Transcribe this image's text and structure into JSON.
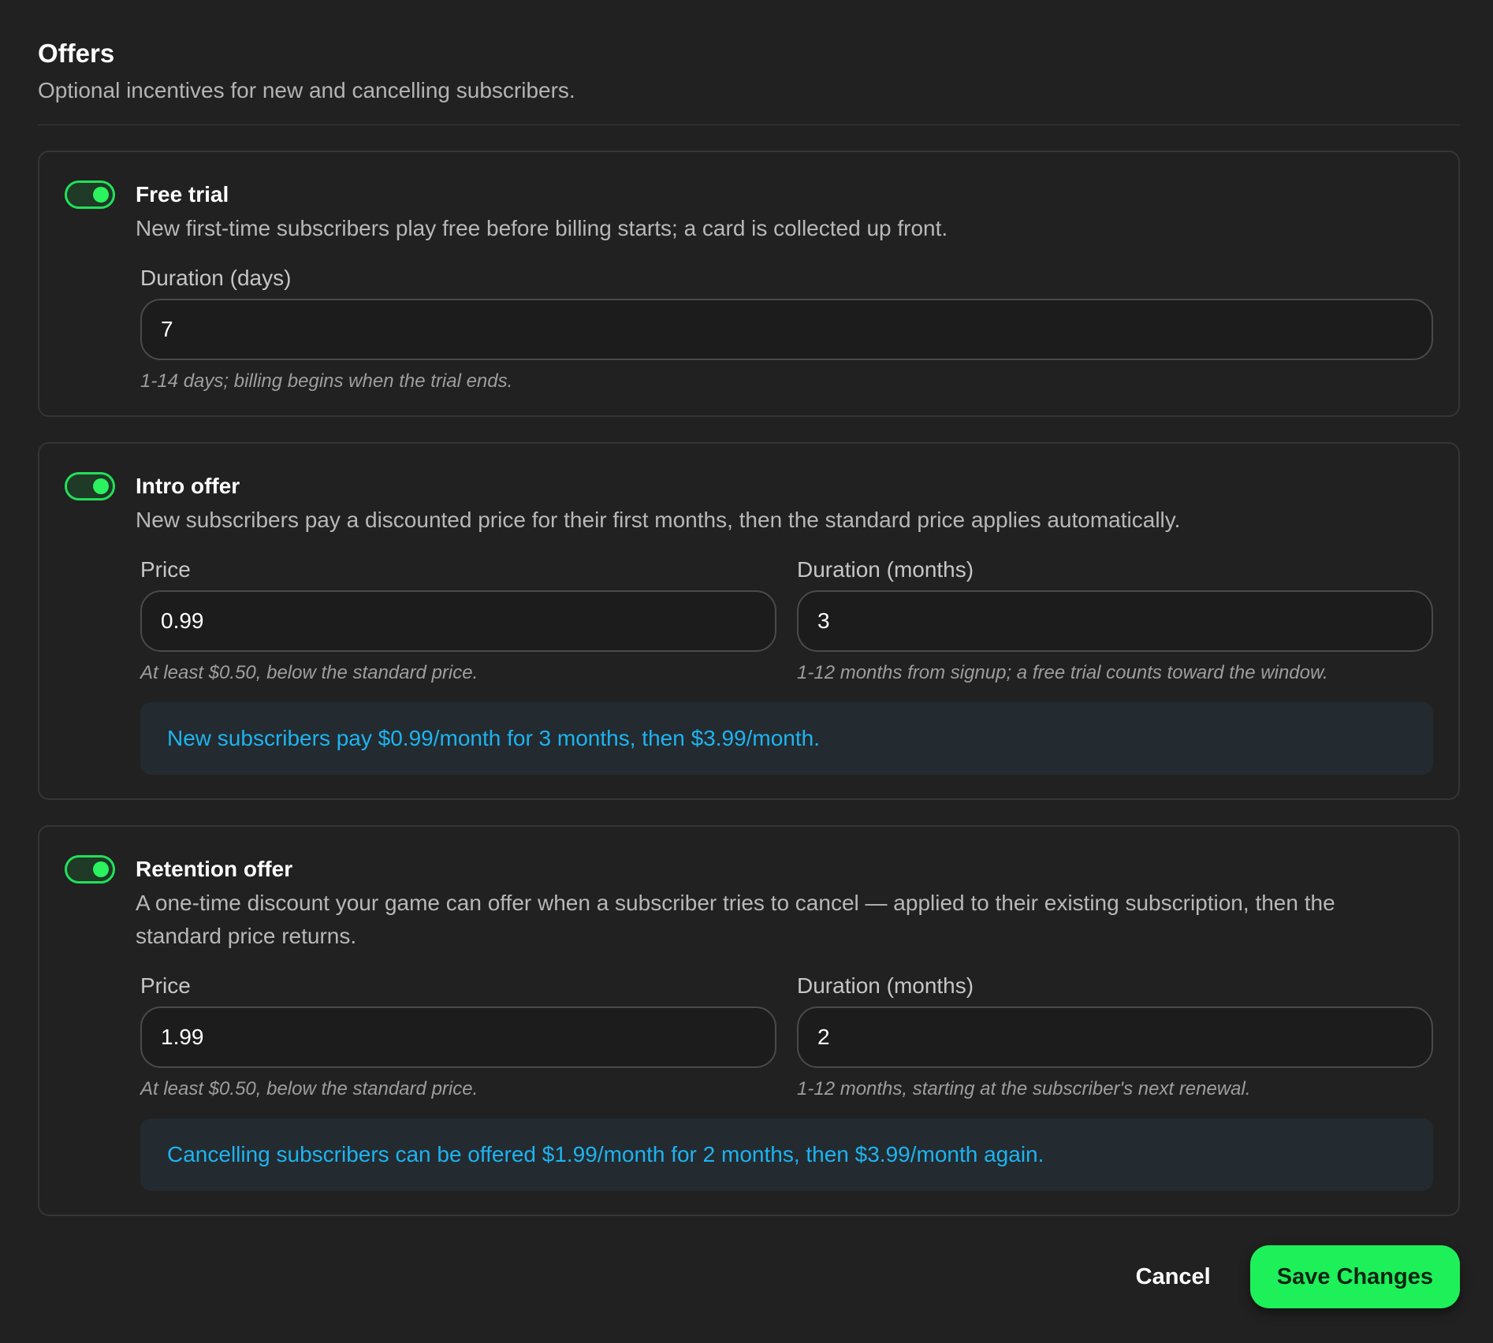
{
  "header": {
    "title": "Offers",
    "subtitle": "Optional incentives for new and cancelling subscribers."
  },
  "colors": {
    "background": "#212121",
    "accent_green": "#1ef05a",
    "info_blue": "#1eb3f0"
  },
  "free_trial": {
    "enabled": true,
    "title": "Free trial",
    "description": "New first-time subscribers play free before billing starts; a card is collected up front.",
    "duration_label": "Duration (days)",
    "duration_value": "7",
    "duration_hint": "1-14 days; billing begins when the trial ends."
  },
  "intro_offer": {
    "enabled": true,
    "title": "Intro offer",
    "description": "New subscribers pay a discounted price for their first months, then the standard price applies automatically.",
    "price_label": "Price",
    "price_value": "0.99",
    "price_hint": "At least $0.50, below the standard price.",
    "duration_label": "Duration (months)",
    "duration_value": "3",
    "duration_hint": "1-12 months from signup; a free trial counts toward the window.",
    "summary": "New subscribers pay $0.99/month for 3 months, then $3.99/month."
  },
  "retention_offer": {
    "enabled": true,
    "title": "Retention offer",
    "description": "A one-time discount your game can offer when a subscriber tries to cancel — applied to their existing subscription, then the standard price returns.",
    "price_label": "Price",
    "price_value": "1.99",
    "price_hint": "At least $0.50, below the standard price.",
    "duration_label": "Duration (months)",
    "duration_value": "2",
    "duration_hint": "1-12 months, starting at the subscriber's next renewal.",
    "summary": "Cancelling subscribers can be offered $1.99/month for 2 months, then $3.99/month again."
  },
  "actions": {
    "cancel_label": "Cancel",
    "save_label": "Save Changes"
  }
}
